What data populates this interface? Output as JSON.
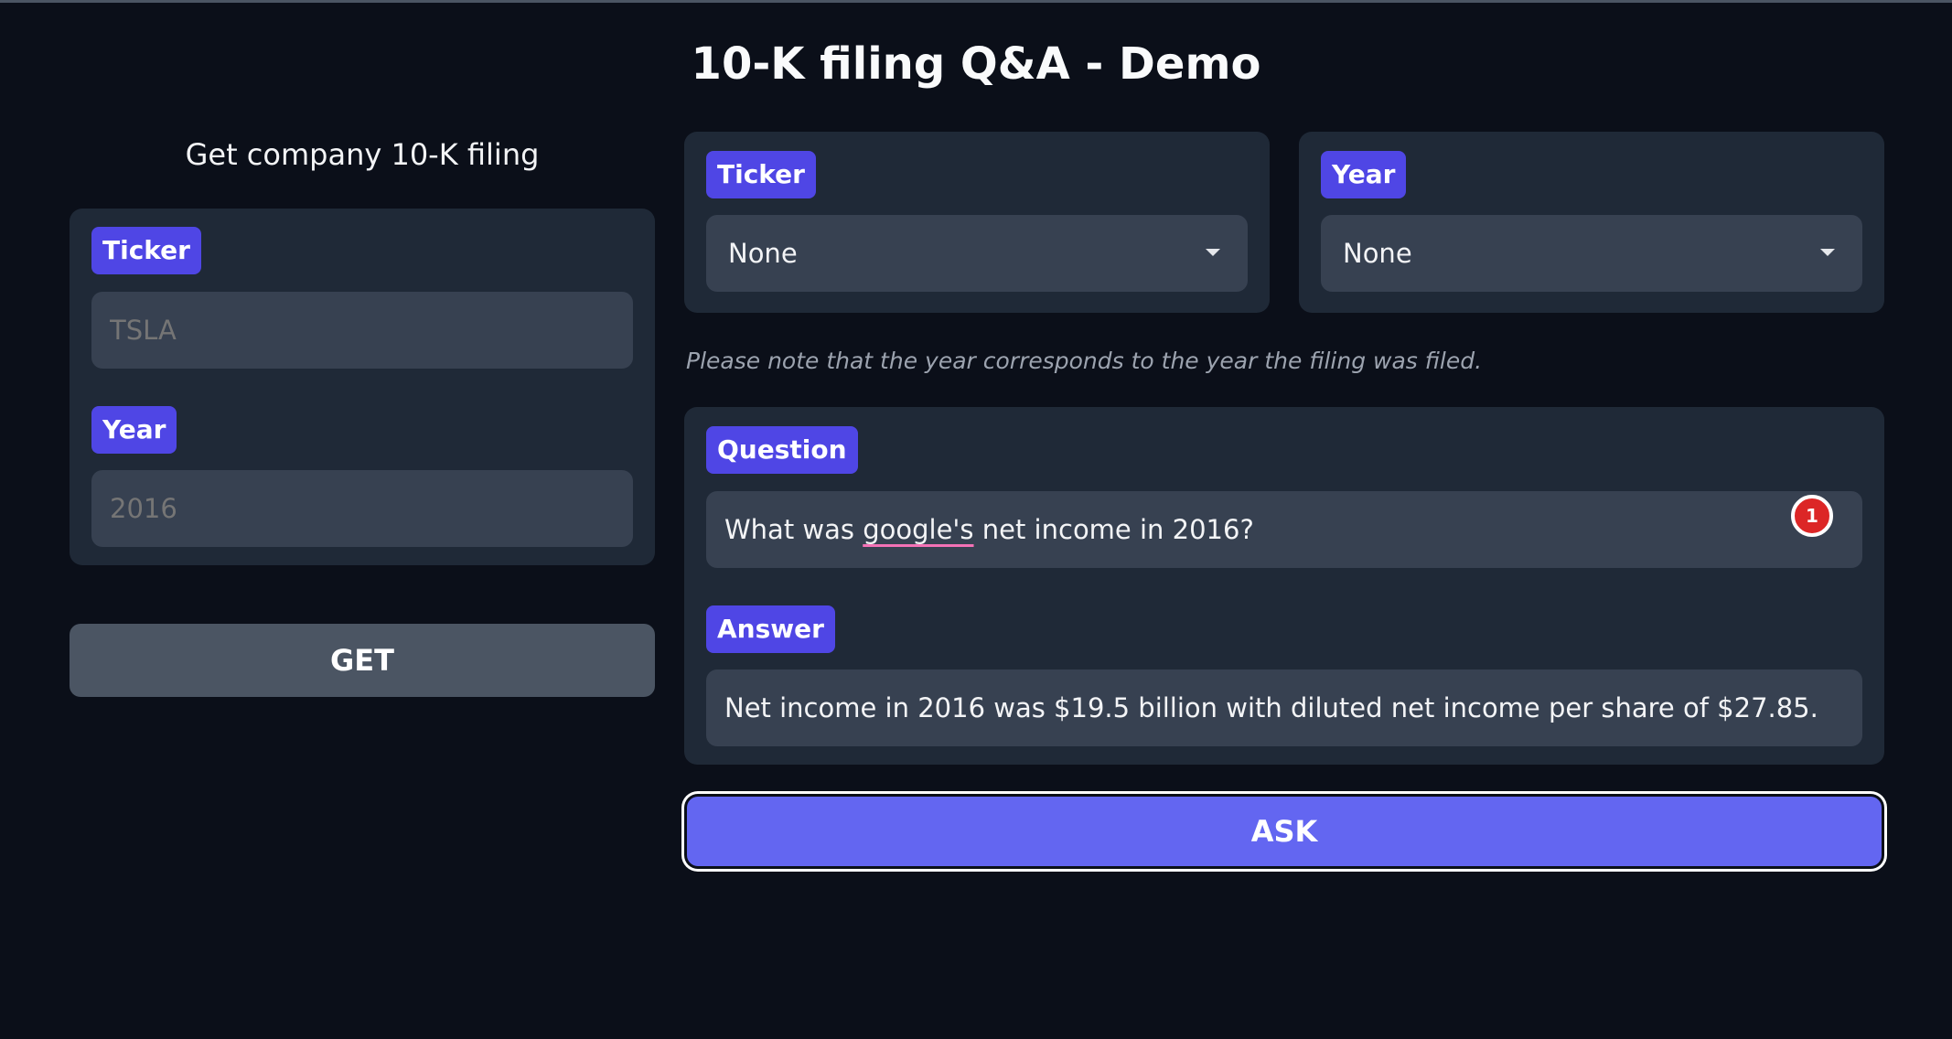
{
  "page": {
    "title": "10-K filing Q&A - Demo"
  },
  "left": {
    "heading": "Get company 10-K filing",
    "ticker": {
      "label": "Ticker",
      "value": "",
      "placeholder": "TSLA"
    },
    "year": {
      "label": "Year",
      "value": "",
      "placeholder": "2016"
    },
    "get_button": "GET"
  },
  "right": {
    "ticker_select": {
      "label": "Ticker",
      "value": "None"
    },
    "year_select": {
      "label": "Year",
      "value": "None"
    },
    "note": "Please note that the year corresponds to the year the filing was filed.",
    "question": {
      "label": "Question",
      "value_prefix": "What was ",
      "value_flagged": "google's",
      "value_suffix": " net income in 2016?",
      "issue_count": "1"
    },
    "answer": {
      "label": "Answer",
      "value": "Net income in 2016 was $19.5 billion with diluted net income per share of $27.85."
    },
    "ask_button": "ASK"
  },
  "colors": {
    "background": "#0b0f19",
    "panel": "#1f2937",
    "field": "#374151",
    "label_chip": "#4f46e5",
    "ask_button": "#6366f1",
    "get_button": "#4b5563",
    "badge": "#dc2626"
  }
}
